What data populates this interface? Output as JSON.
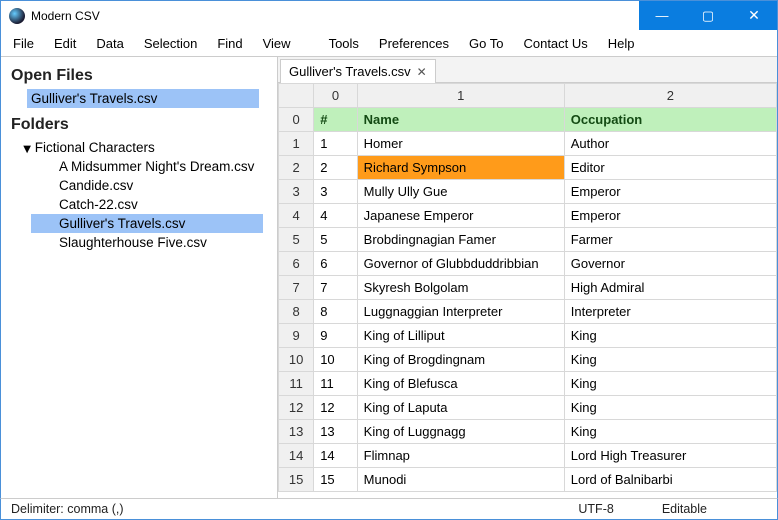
{
  "window": {
    "title": "Modern CSV"
  },
  "menu": [
    "File",
    "Edit",
    "Data",
    "Selection",
    "Find",
    "View",
    "",
    "Tools",
    "Preferences",
    "Go To",
    "Contact Us",
    "Help"
  ],
  "sidebar": {
    "open_heading": "Open Files",
    "open_files": [
      {
        "label": "Gulliver's Travels.csv",
        "selected": true
      }
    ],
    "folders_heading": "Folders",
    "folder_name": "Fictional Characters",
    "files": [
      {
        "label": "A Midsummer Night's Dream.csv",
        "selected": false
      },
      {
        "label": "Candide.csv",
        "selected": false
      },
      {
        "label": "Catch-22.csv",
        "selected": false
      },
      {
        "label": "Gulliver's Travels.csv",
        "selected": true
      },
      {
        "label": "Slaughterhouse Five.csv",
        "selected": false
      }
    ]
  },
  "tab": {
    "label": "Gulliver's Travels.csv",
    "close": "✕"
  },
  "columns": [
    "0",
    "1",
    "2"
  ],
  "header_row": {
    "idx": "0",
    "cells": [
      "#",
      "Name",
      "Occupation"
    ]
  },
  "rows": [
    {
      "idx": "1",
      "cells": [
        "1",
        "Homer",
        "Author"
      ],
      "hl": -1
    },
    {
      "idx": "2",
      "cells": [
        "2",
        "Richard Sympson",
        "Editor"
      ],
      "hl": 1
    },
    {
      "idx": "3",
      "cells": [
        "3",
        "Mully Ully Gue",
        "Emperor"
      ],
      "hl": -1
    },
    {
      "idx": "4",
      "cells": [
        "4",
        "Japanese Emperor",
        "Emperor"
      ],
      "hl": -1
    },
    {
      "idx": "5",
      "cells": [
        "5",
        "Brobdingnagian Famer",
        "Farmer"
      ],
      "hl": -1
    },
    {
      "idx": "6",
      "cells": [
        "6",
        "Governor of Glubbduddribbian",
        "Governor"
      ],
      "hl": -1
    },
    {
      "idx": "7",
      "cells": [
        "7",
        "Skyresh Bolgolam",
        "High Admiral"
      ],
      "hl": -1
    },
    {
      "idx": "8",
      "cells": [
        "8",
        "Luggnaggian Interpreter",
        "Interpreter"
      ],
      "hl": -1
    },
    {
      "idx": "9",
      "cells": [
        "9",
        "King of Lilliput",
        "King"
      ],
      "hl": -1
    },
    {
      "idx": "10",
      "cells": [
        "10",
        "King of Brogdingnam",
        "King"
      ],
      "hl": -1
    },
    {
      "idx": "11",
      "cells": [
        "11",
        "King of Blefusca",
        "King"
      ],
      "hl": -1
    },
    {
      "idx": "12",
      "cells": [
        "12",
        "King of Laputa",
        "King"
      ],
      "hl": -1
    },
    {
      "idx": "13",
      "cells": [
        "13",
        "King of Luggnagg",
        "King"
      ],
      "hl": -1
    },
    {
      "idx": "14",
      "cells": [
        "14",
        "Flimnap",
        "Lord High Treasurer"
      ],
      "hl": -1
    },
    {
      "idx": "15",
      "cells": [
        "15",
        "Munodi",
        "Lord of Balnibarbi"
      ],
      "hl": -1
    }
  ],
  "status": {
    "delimiter": "Delimiter: comma (,)",
    "encoding": "UTF-8",
    "editable": "Editable"
  }
}
